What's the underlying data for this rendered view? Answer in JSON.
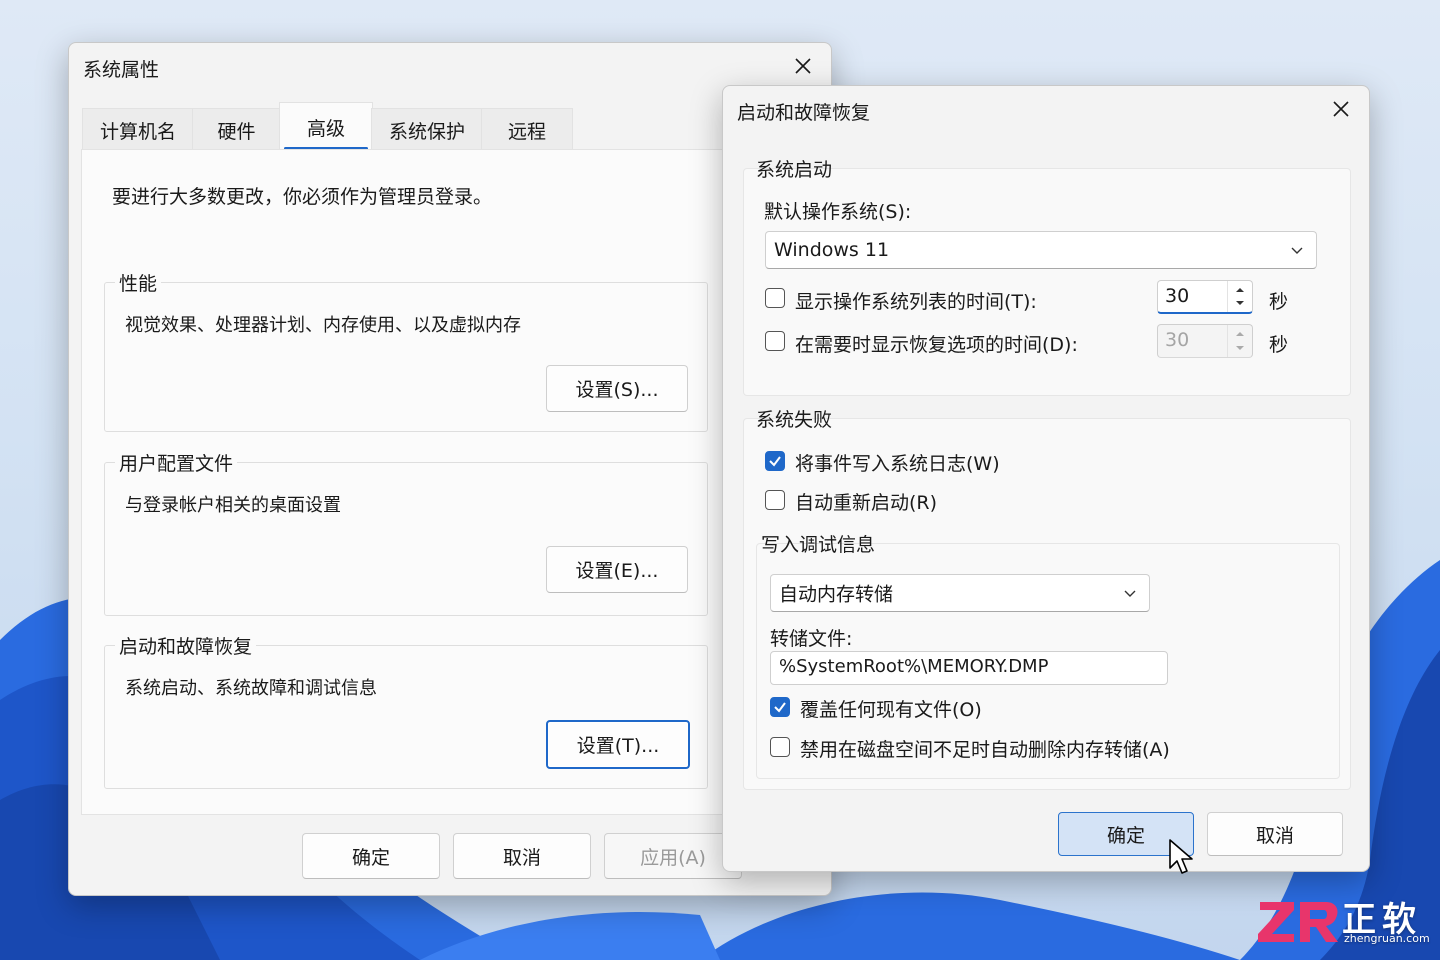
{
  "system_properties": {
    "title": "系统属性",
    "tabs": [
      {
        "label": "计算机名"
      },
      {
        "label": "硬件"
      },
      {
        "label": "高级"
      },
      {
        "label": "系统保护"
      },
      {
        "label": "远程"
      }
    ],
    "active_tab": "高级",
    "intro": "要进行大多数更改，你必须作为管理员登录。",
    "performance": {
      "title": "性能",
      "desc": "视觉效果、处理器计划、内存使用、以及虚拟内存",
      "button": "设置(S)..."
    },
    "user_profiles": {
      "title": "用户配置文件",
      "desc": "与登录帐户相关的桌面设置",
      "button": "设置(E)..."
    },
    "startup_recovery": {
      "title": "启动和故障恢复",
      "desc": "系统启动、系统故障和调试信息",
      "button": "设置(T)..."
    },
    "ok": "确定",
    "cancel": "取消",
    "apply": "应用(A)"
  },
  "startup_dialog": {
    "title": "启动和故障恢复",
    "system_startup": {
      "title": "系统启动",
      "default_os_label": "默认操作系统(S):",
      "default_os_value": "Windows 11",
      "show_os_list": {
        "label": "显示操作系统列表的时间(T):",
        "checked": false,
        "value": "30",
        "unit": "秒"
      },
      "show_recovery": {
        "label": "在需要时显示恢复选项的时间(D):",
        "checked": false,
        "value": "30",
        "unit": "秒"
      }
    },
    "system_failure": {
      "title": "系统失败",
      "write_event": {
        "label": "将事件写入系统日志(W)",
        "checked": true
      },
      "auto_restart": {
        "label": "自动重新启动(R)",
        "checked": false
      },
      "debug_info": {
        "title": "写入调试信息",
        "dump_type": "自动内存转储",
        "dump_file_label": "转储文件:",
        "dump_file_value": "%SystemRoot%\\MEMORY.DMP",
        "overwrite": {
          "label": "覆盖任何现有文件(O)",
          "checked": true
        },
        "disable_auto_delete": {
          "label": "禁用在磁盘空间不足时自动删除内存转储(A)",
          "checked": false
        }
      }
    },
    "ok": "确定",
    "cancel": "取消"
  },
  "watermark": {
    "brand": "正软",
    "domain": "zhengruan.com"
  },
  "colors": {
    "accent": "#1f68c9",
    "wallpaper_blue": "#1f5fd6"
  }
}
